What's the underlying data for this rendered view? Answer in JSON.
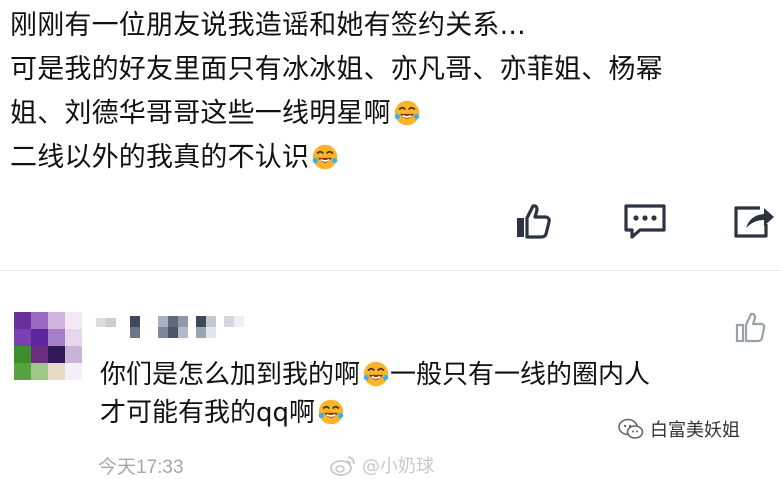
{
  "post": {
    "lines": [
      "刚刚有一位朋友说我造谣和她有签约关系...",
      "可是我的好友里面只有冰冰姐、亦凡哥、亦菲姐、杨幂",
      "姐、刘德华哥哥这些一线明星啊",
      "二线以外的我真的不认识"
    ]
  },
  "actions": {
    "like_icon": "thumbs-up-icon",
    "comment_icon": "comment-bubble-icon",
    "share_icon": "share-icon"
  },
  "comment": {
    "lines": [
      "你们是怎么加到我的啊",
      "一般只有一线的圈内人",
      "才可能有我的",
      "qq",
      "啊"
    ],
    "timestamp": "今天17:33",
    "like_icon": "thumbs-up-outline-icon"
  },
  "watermarks": {
    "weibo": "@小奶球",
    "wechat": "白富美妖姐"
  },
  "colors": {
    "text": "#111111",
    "meta": "#a8a8a8",
    "emoji": "#f7b52c",
    "icon": "#2b3440"
  }
}
